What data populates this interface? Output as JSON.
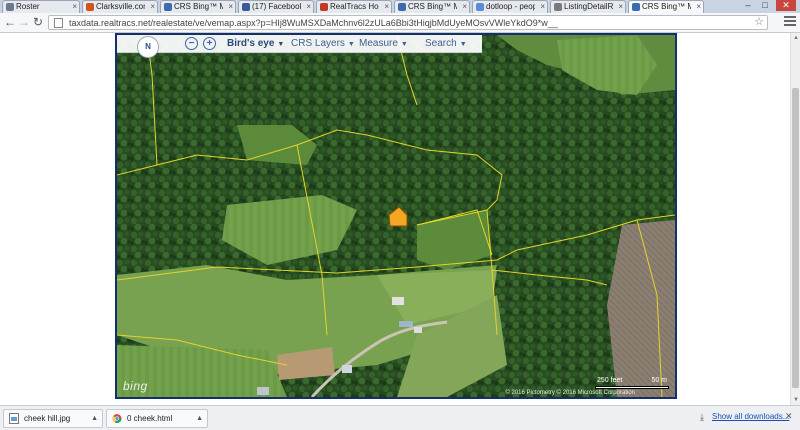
{
  "browser": {
    "tabs": [
      {
        "label": "Roster",
        "color": "#6c7a8f"
      },
      {
        "label": "Clarksville.com Real",
        "color": "#d0541b"
      },
      {
        "label": "CRS Bing™ Maps",
        "color": "#3d6bb0"
      },
      {
        "label": "(17) Facebook",
        "color": "#3b5998"
      },
      {
        "label": "RealTracs Home Fi",
        "color": "#c0392b"
      },
      {
        "label": "CRS Bing™ Maps",
        "color": "#3d6bb0"
      },
      {
        "label": "dotloop - people",
        "color": "#5b8dd6"
      },
      {
        "label": "ListingDetailReport",
        "color": "#7a7a7a"
      },
      {
        "label": "CRS Bing™ Maps",
        "color": "#3d6bb0",
        "active": true
      }
    ],
    "window_controls": {
      "minimize": "–",
      "maximize": "□",
      "close": "✕"
    },
    "url": "taxdata.realtracs.net/realestate/ve/vemap.aspx?p=HIj8WuMSXDaMchnv6l2zULa6Bbi3tHiqjbMdUyeMOsvVWleYkdO9*w__"
  },
  "map": {
    "compass_label": "N",
    "zoom_in": "+",
    "zoom_out": "−",
    "menus": [
      {
        "label": "Bird's eye",
        "bold": true
      },
      {
        "label": "CRS Layers"
      },
      {
        "label": "Measure"
      },
      {
        "label": "Search"
      }
    ],
    "bing_label": "bing",
    "scale": {
      "feet": "250 feet",
      "meters": "50 m"
    },
    "copyright": "© 2016 Pictometry  © 2016 Microsoft Corporation"
  },
  "downloads": {
    "items": [
      {
        "name": "cheek hill.jpg",
        "icon": "image-file-icon"
      },
      {
        "name": "0 cheek.html",
        "icon": "chrome-html-icon"
      }
    ],
    "show_all": "Show all downloads..."
  },
  "colors": {
    "tab_bg": "#e6e9ee",
    "map_border": "#14306a",
    "parcel_lines": "#e3d42a",
    "link": "#1a4fb5"
  }
}
